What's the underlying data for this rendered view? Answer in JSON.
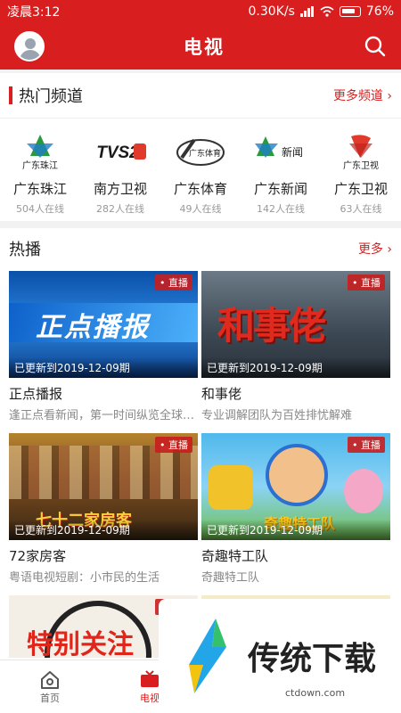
{
  "status": {
    "time": "凌晨3:12",
    "speed": "0.30K/s",
    "battery": "76%"
  },
  "header": {
    "title": "电视"
  },
  "hot_channels": {
    "title": "热门频道",
    "more": "更多频道 ›",
    "items": [
      {
        "name": "广东珠江",
        "count": "504人在线",
        "logo_text": "广东珠江"
      },
      {
        "name": "南方卫视",
        "count": "282人在线",
        "logo_text": "TVS2"
      },
      {
        "name": "广东体育",
        "count": "49人在线",
        "logo_text": "广东体育"
      },
      {
        "name": "广东新闻",
        "count": "142人在线",
        "logo_text": "新闻"
      },
      {
        "name": "广东卫视",
        "count": "63人在线",
        "logo_text": "广东卫视"
      }
    ]
  },
  "hot_play": {
    "title": "热播",
    "more": "更多 ›",
    "live_label": "• 直播",
    "cards": [
      {
        "title": "正点播报",
        "desc": "逢正点看新闻，第一时间纵览全球…",
        "updated": "已更新到2019-12-09期",
        "thumb_text": "正点播报"
      },
      {
        "title": "和事佬",
        "desc": "专业调解团队为百姓排忧解难",
        "updated": "已更新到2019-12-09期",
        "thumb_text": "和事佬"
      },
      {
        "title": "72家房客",
        "desc": "粤语电视短剧：小市民的生活",
        "updated": "已更新到2019-12-09期",
        "thumb_text": "七十二家房客"
      },
      {
        "title": "奇趣特工队",
        "desc": "奇趣特工队",
        "updated": "已更新到2019-12-09期",
        "thumb_text": "奇趣特工队"
      },
      {
        "title": "",
        "desc": "",
        "updated": "",
        "thumb_text": "特别关注"
      }
    ]
  },
  "tabs": [
    {
      "label": "首页",
      "icon": "home-icon"
    },
    {
      "label": "电视",
      "icon": "tv-icon"
    }
  ],
  "watermark": {
    "text": "传统下载",
    "url": "ctdown.com"
  },
  "colors": {
    "accent": "#d81e1e"
  }
}
